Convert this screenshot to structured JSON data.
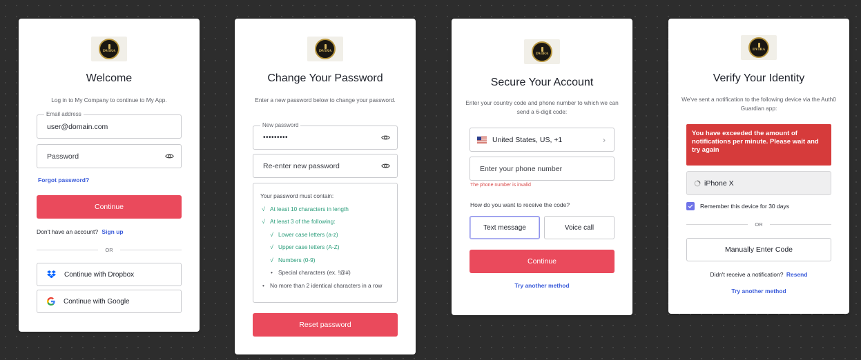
{
  "logo": {
    "text": "DVIRA"
  },
  "login": {
    "title": "Welcome",
    "subtitle": "Log in to My Company to continue to My App.",
    "email_label": "Email address",
    "email_value": "user@domain.com",
    "password_placeholder": "Password",
    "forgot_link": "Forgot password?",
    "continue_label": "Continue",
    "no_account_text": "Don't have an account?",
    "signup_link": "Sign up",
    "divider_text": "OR",
    "social": [
      {
        "label": "Continue with Dropbox",
        "icon": "dropbox-icon"
      },
      {
        "label": "Continue with Google",
        "icon": "google-icon"
      }
    ]
  },
  "change_password": {
    "title": "Change Your Password",
    "subtitle": "Enter a new password below to change your password.",
    "new_password_label": "New password",
    "new_password_value": "•••••••••",
    "reenter_placeholder": "Re-enter new password",
    "rules_title": "Your password must contain:",
    "rules": {
      "r1": "At least 10 characters in length",
      "r2": "At least 3 of the following:",
      "r3": "Lower case letters (a-z)",
      "r4": "Upper case letters (A-Z)",
      "r5": "Numbers (0-9)",
      "r6": "Special characters (ex. !@#)",
      "r7": "No more than 2 identical characters in a row"
    },
    "check_mark": "√",
    "bullet_mark": "•",
    "reset_label": "Reset password"
  },
  "secure_account": {
    "title": "Secure Your Account",
    "subtitle": "Enter your country code and phone number to which we can send a 6-digit code:",
    "country_value": "United States, US, +1",
    "phone_placeholder": "Enter your phone number",
    "error_text": "The phone number is invalid",
    "question": "How do you want to receive the code?",
    "option_text": "Text message",
    "option_voice": "Voice call",
    "continue_label": "Continue",
    "try_another": "Try another method"
  },
  "verify": {
    "title": "Verify Your Identity",
    "subtitle": "We've sent a notification to the following device via the Auth0 Guardian app:",
    "error_text": "You have exceeded the amount of notifications per minute. Please wait and try again",
    "device_name": "iPhone X",
    "remember_label": "Remember this device for 30 days",
    "remember_checked": true,
    "divider_text": "OR",
    "manual_label": "Manually Enter Code",
    "no_notification_text": "Didn't receive a notification?",
    "resend_link": "Resend",
    "try_another": "Try another method"
  },
  "colors": {
    "primary": "#ea4a5c",
    "link": "#3a5bd9",
    "success": "#2a9d7a",
    "error": "#d63b3b"
  }
}
